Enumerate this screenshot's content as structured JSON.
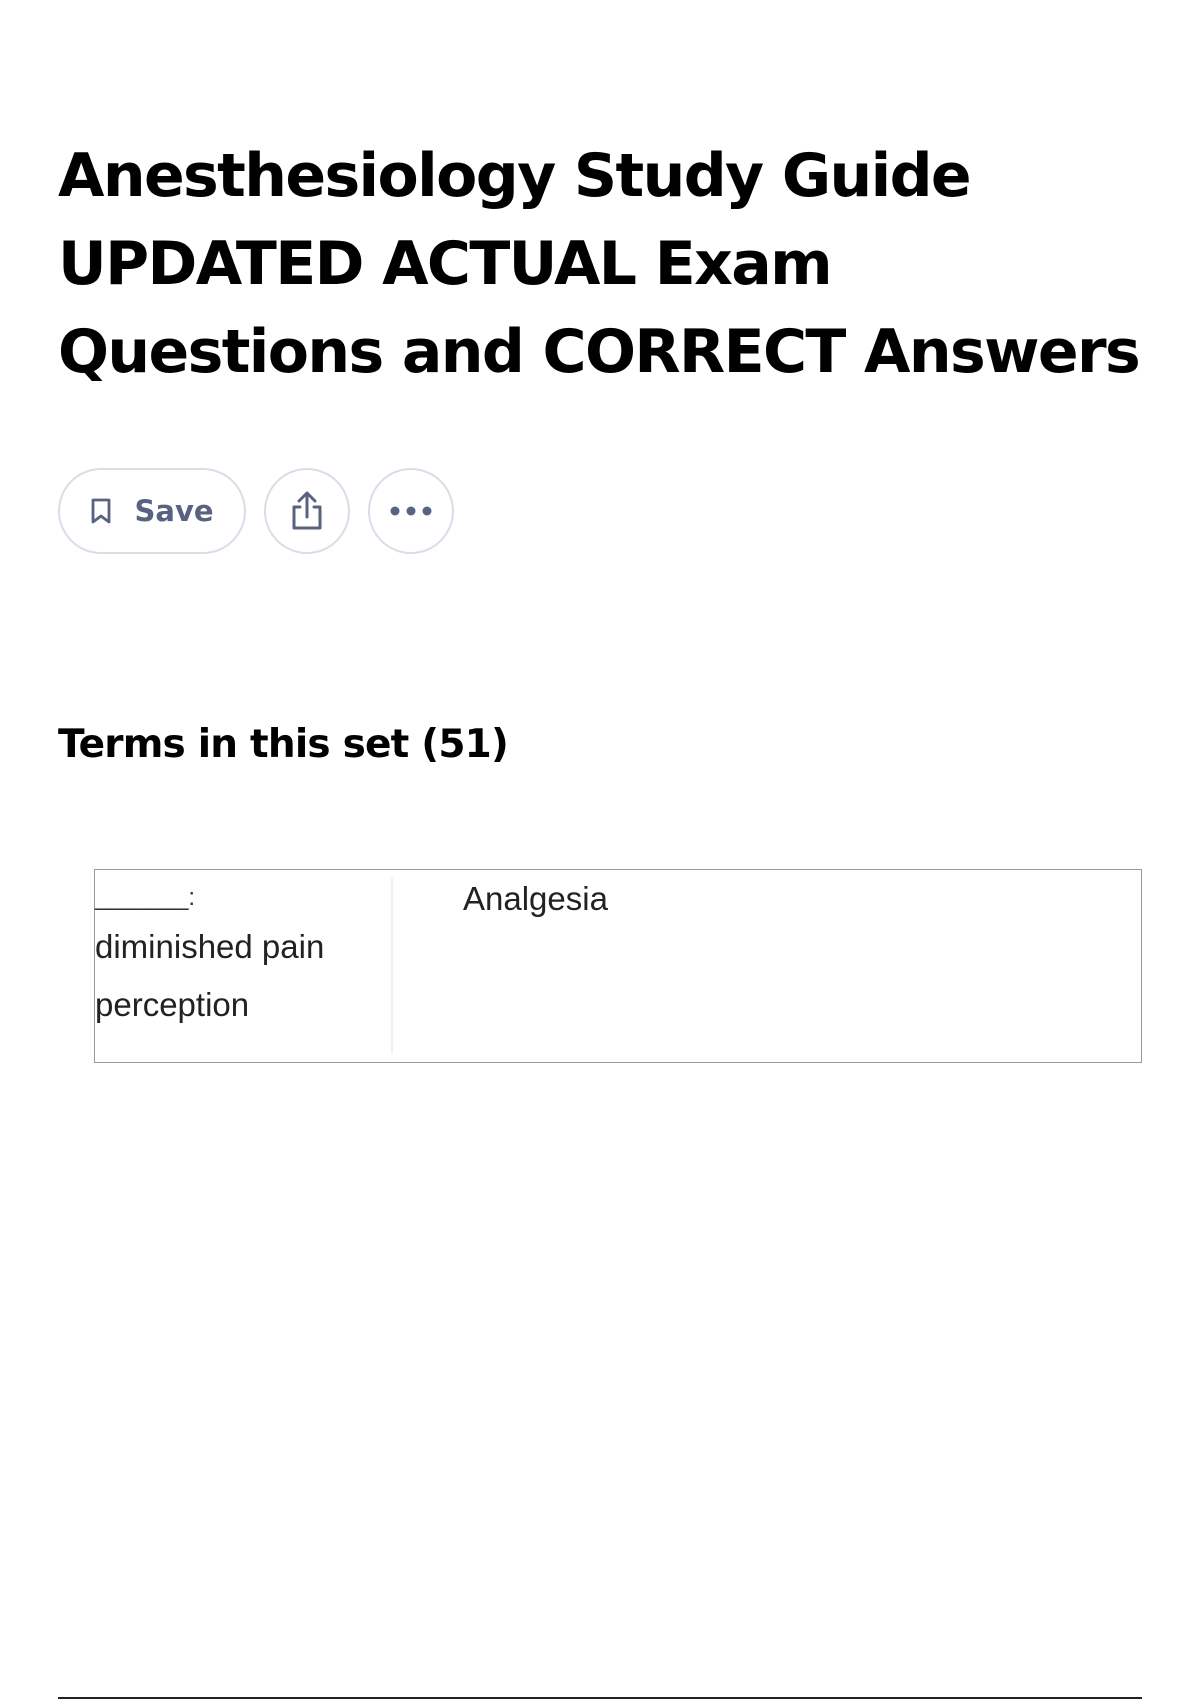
{
  "header": {
    "title_lines": [
      "Anesthesiology Study Guide",
      "UPDATED ACTUAL Exam",
      "Questions and CORRECT Answers"
    ]
  },
  "actions": {
    "save_label": "Save",
    "save_icon": "bookmark-icon",
    "share_icon": "share-icon",
    "more_icon": "more-horizontal-icon"
  },
  "terms_section": {
    "heading": "Terms in this set (51)",
    "cards": [
      {
        "term_blank": "_______:",
        "term_text": "diminished pain perception",
        "term_line1": "diminished pain",
        "term_line2": "perception",
        "definition": "Analgesia"
      }
    ]
  }
}
